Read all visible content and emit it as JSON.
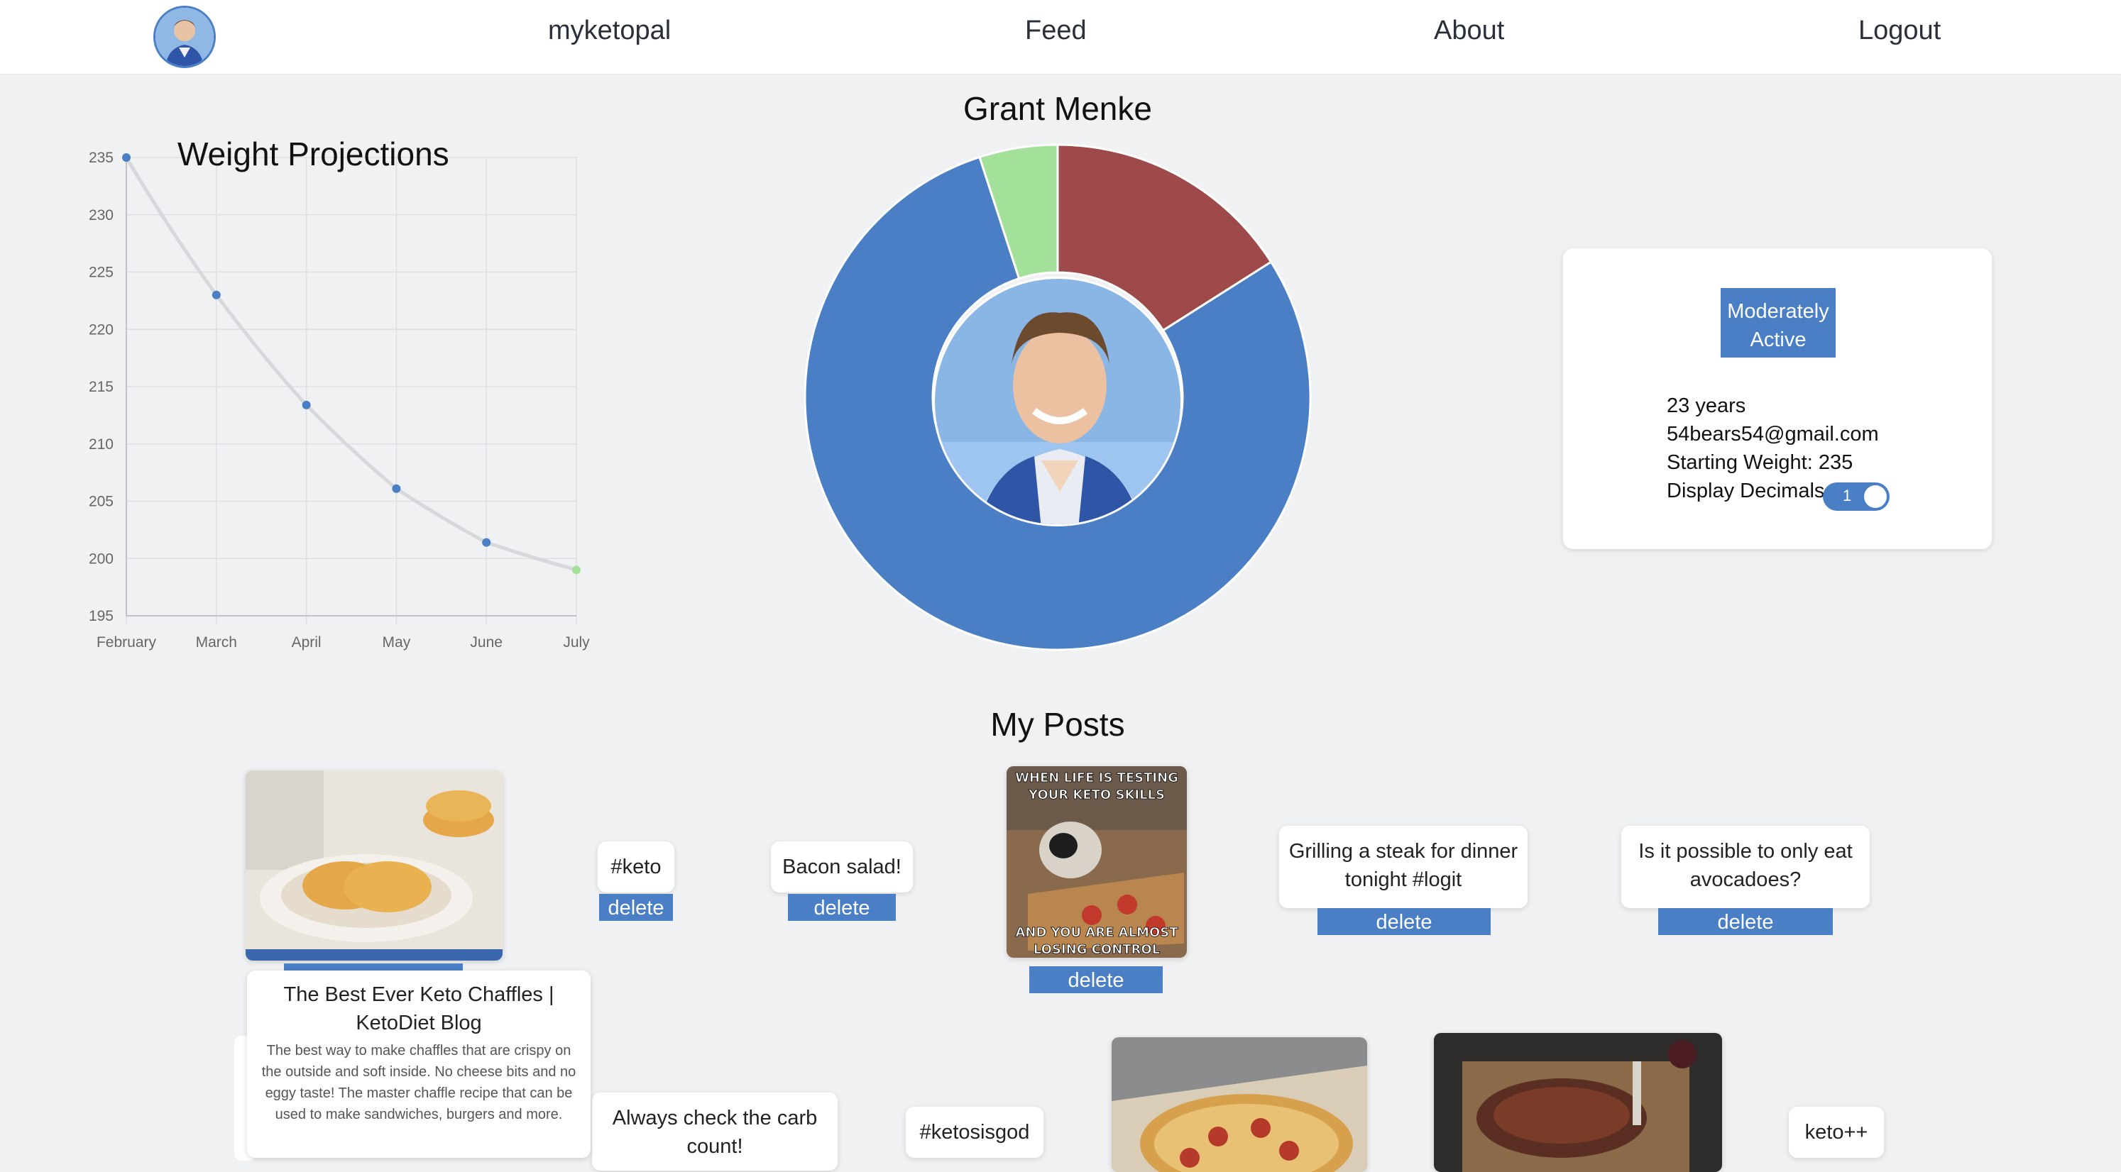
{
  "nav": {
    "brand": "myketopal",
    "links": [
      "Feed",
      "About",
      "Logout"
    ]
  },
  "profile": {
    "name": "Grant Menke",
    "activity_level": "Moderately Active",
    "age": "23 years",
    "email": "54bears54@gmail.com",
    "starting_weight": "Starting Weight: 235",
    "display_decimals_label": "Display Decimals",
    "display_decimals_value": "1"
  },
  "chart_data": [
    {
      "type": "line",
      "title": "Weight Projections",
      "categories": [
        "February",
        "March",
        "April",
        "May",
        "June",
        "July"
      ],
      "values": [
        235,
        223,
        213.4,
        206.1,
        201.4,
        199
      ],
      "ylim": [
        195,
        235
      ],
      "yticks": [
        195,
        200,
        205,
        210,
        215,
        220,
        225,
        230,
        235
      ],
      "grid": true,
      "colors": {
        "line": "#d6d8dc",
        "point": "#4a7fc6",
        "last_point": "#a3e19a"
      }
    },
    {
      "type": "pie",
      "style": "doughnut",
      "slices": [
        {
          "value": 16,
          "color": "#9e4a4a"
        },
        {
          "value": 79,
          "color": "#4a7fc6"
        },
        {
          "value": 5,
          "color": "#a3e19a"
        }
      ]
    }
  ],
  "posts": {
    "heading": "My Posts",
    "delete_label": "delete",
    "items_row1": [
      {
        "type": "image",
        "image": "waffles-photo"
      },
      {
        "type": "text",
        "text": "#keto"
      },
      {
        "type": "text",
        "text": "Bacon salad!"
      },
      {
        "type": "image",
        "image": "keto-meme",
        "meme_top": "WHEN LIFE IS TESTING YOUR KETO SKILLS",
        "meme_bottom": "AND YOU ARE ALMOST LOSING CONTROL"
      },
      {
        "type": "text",
        "text": "Grilling a steak for dinner tonight #logit"
      },
      {
        "type": "text",
        "text": "Is it possible to only eat avocadoes?"
      }
    ],
    "items_row2": [
      {
        "type": "text",
        "text": "Always check the carb count!"
      },
      {
        "type": "text",
        "text": "#ketosisgod"
      },
      {
        "type": "image",
        "image": "pizza-photo"
      },
      {
        "type": "image",
        "image": "steak-photo"
      },
      {
        "type": "text",
        "text": "keto++"
      }
    ],
    "link_preview": {
      "title": "The Best Ever Keto Chaffles | KetoDiet Blog",
      "description": "The best way to make chaffles that are crispy on the outside and soft inside. No cheese bits and no eggy taste! The master chaffle recipe that can be used to make sandwiches, burgers and more."
    }
  },
  "colors": {
    "accent": "#4a7fc6",
    "background": "#f0f1f3",
    "pie_red": "#9e4a4a",
    "pie_green": "#a3e19a"
  }
}
